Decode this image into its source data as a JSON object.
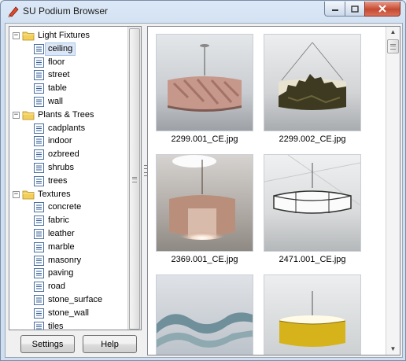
{
  "window": {
    "title": "SU Podium Browser"
  },
  "tree": {
    "groups": [
      {
        "label": "Light Fixtures",
        "items": [
          "ceiling",
          "floor",
          "street",
          "table",
          "wall"
        ]
      },
      {
        "label": "Plants & Trees",
        "items": [
          "cadplants",
          "indoor",
          "ozbreed",
          "shrubs",
          "trees"
        ]
      },
      {
        "label": "Textures",
        "items": [
          "concrete",
          "fabric",
          "leather",
          "marble",
          "masonry",
          "paving",
          "road",
          "stone_surface",
          "stone_wall",
          "tiles"
        ]
      }
    ],
    "selected": "ceiling"
  },
  "buttons": {
    "settings": "Settings",
    "help": "Help"
  },
  "gallery": {
    "items": [
      {
        "caption": "2299.001_CE.jpg"
      },
      {
        "caption": "2299.002_CE.jpg"
      },
      {
        "caption": "2369.001_CE.jpg"
      },
      {
        "caption": "2471.001_CE.jpg"
      },
      {
        "caption": ""
      },
      {
        "caption": ""
      }
    ]
  },
  "colors": {
    "selection": "#dbe7f7",
    "folder": "#f2cf5a",
    "close_button": "#c54a31"
  }
}
